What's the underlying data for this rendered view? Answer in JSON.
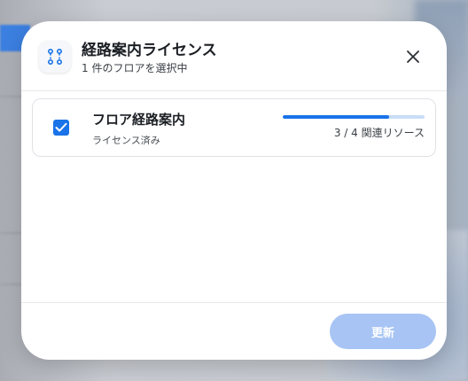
{
  "dialog": {
    "title": "経路案内ライセンス",
    "subtitle": "1 件のフロアを選択中",
    "header_icon": "route-icon",
    "close_icon": "close-icon"
  },
  "items": [
    {
      "title": "フロア経路案内",
      "status": "ライセンス済み",
      "checked": true,
      "progress_text": "3 / 4 関連リソース",
      "progress_fraction": 0.75
    }
  ],
  "footer": {
    "update_label": "更新",
    "update_disabled": true
  },
  "colors": {
    "accent": "#1a73e8",
    "progress_track": "#c9ddf8",
    "button_disabled": "#a7c4f4"
  }
}
